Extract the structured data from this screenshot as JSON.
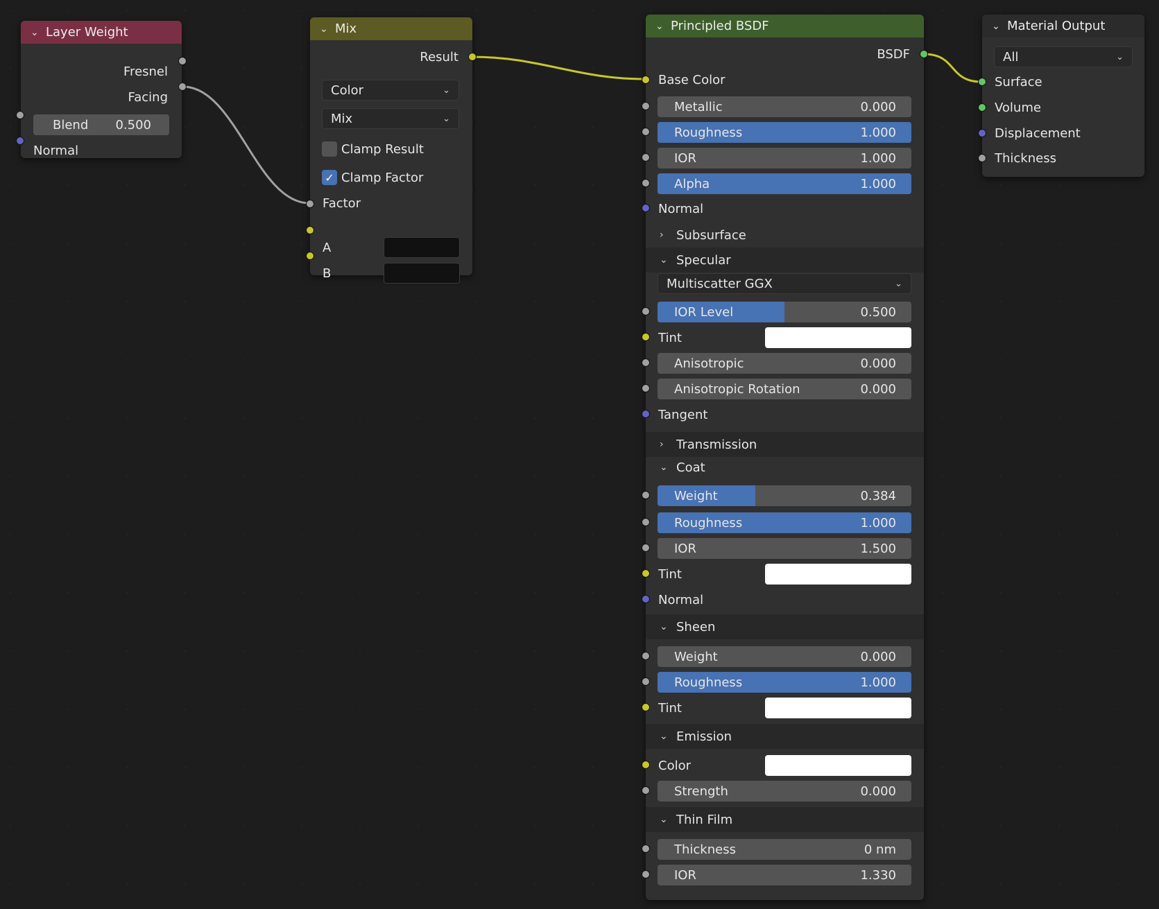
{
  "colors": {
    "background": "#1d1d1d",
    "node_body": "#303030",
    "header_layer_weight": "#7a2f45",
    "header_mix": "#5c5b23",
    "header_principled": "#3e5f2c",
    "header_output": "#2b2b2b",
    "slider_fill": "#4772b3",
    "wire_color": "#c7c729",
    "wire_gray": "#a1a1a1"
  },
  "layer_weight": {
    "title": "Layer Weight",
    "outputs": [
      "Fresnel",
      "Facing"
    ],
    "blend_label": "Blend",
    "blend_value": "0.500",
    "normal_label": "Normal"
  },
  "mix": {
    "title": "Mix",
    "output": "Result",
    "data_type": "Color",
    "blend_mode": "Mix",
    "clamp_result": "Clamp Result",
    "clamp_result_checked": false,
    "clamp_factor": "Clamp Factor",
    "clamp_factor_checked": true,
    "factor_label": "Factor",
    "a_label": "A",
    "b_label": "B"
  },
  "principled": {
    "title": "Principled BSDF",
    "output": "BSDF",
    "base_color": "Base Color",
    "metallic": {
      "label": "Metallic",
      "value": "0.000",
      "fraction": 0
    },
    "roughness": {
      "label": "Roughness",
      "value": "1.000",
      "fraction": 1
    },
    "ior": {
      "label": "IOR",
      "value": "1.000",
      "fraction": 0
    },
    "alpha": {
      "label": "Alpha",
      "value": "1.000",
      "fraction": 1
    },
    "normal": "Normal",
    "subsurface": {
      "title": "Subsurface",
      "expanded": false
    },
    "specular": {
      "title": "Specular",
      "expanded": true,
      "distribution": "Multiscatter GGX",
      "ior_level": {
        "label": "IOR Level",
        "value": "0.500",
        "fraction": 0.5
      },
      "tint": "Tint",
      "anisotropic": {
        "label": "Anisotropic",
        "value": "0.000",
        "fraction": 0
      },
      "anisotropic_rotation": {
        "label": "Anisotropic Rotation",
        "value": "0.000",
        "fraction": 0
      },
      "tangent": "Tangent"
    },
    "transmission": {
      "title": "Transmission",
      "expanded": false
    },
    "coat": {
      "title": "Coat",
      "expanded": true,
      "weight": {
        "label": "Weight",
        "value": "0.384",
        "fraction": 0.384
      },
      "roughness": {
        "label": "Roughness",
        "value": "1.000",
        "fraction": 1
      },
      "ior": {
        "label": "IOR",
        "value": "1.500",
        "fraction": 0
      },
      "tint": "Tint",
      "normal": "Normal"
    },
    "sheen": {
      "title": "Sheen",
      "expanded": true,
      "weight": {
        "label": "Weight",
        "value": "0.000",
        "fraction": 0
      },
      "roughness": {
        "label": "Roughness",
        "value": "1.000",
        "fraction": 1
      },
      "tint": "Tint"
    },
    "emission": {
      "title": "Emission",
      "expanded": true,
      "color": "Color",
      "strength": {
        "label": "Strength",
        "value": "0.000",
        "fraction": 0
      }
    },
    "thin_film": {
      "title": "Thin Film",
      "expanded": true,
      "thickness": {
        "label": "Thickness",
        "value": "0 nm",
        "fraction": 0
      },
      "ior": {
        "label": "IOR",
        "value": "1.330",
        "fraction": 0
      }
    }
  },
  "material_output": {
    "title": "Material Output",
    "target": "All",
    "inputs": [
      "Surface",
      "Volume",
      "Displacement",
      "Thickness"
    ]
  }
}
